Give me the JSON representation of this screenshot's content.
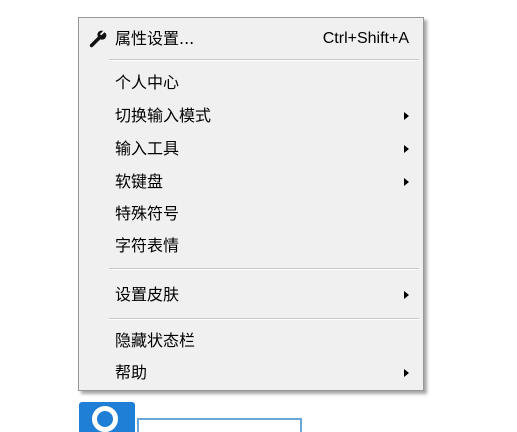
{
  "menu": {
    "items": [
      {
        "label": "属性设置...",
        "shortcut": "Ctrl+Shift+A",
        "icon": "wrench-icon"
      },
      {
        "label": "个人中心"
      },
      {
        "label": "切换输入模式",
        "submenu": true
      },
      {
        "label": "输入工具",
        "submenu": true
      },
      {
        "label": "软键盘",
        "submenu": true
      },
      {
        "label": "特殊符号"
      },
      {
        "label": "字符表情"
      },
      {
        "label": "设置皮肤",
        "submenu": true
      },
      {
        "label": "隐藏状态栏"
      },
      {
        "label": "帮助",
        "submenu": true
      }
    ]
  },
  "colors": {
    "menu_bg": "#f0f0f0",
    "menu_border": "#979797",
    "tray_blue": "#1f7fd6"
  }
}
